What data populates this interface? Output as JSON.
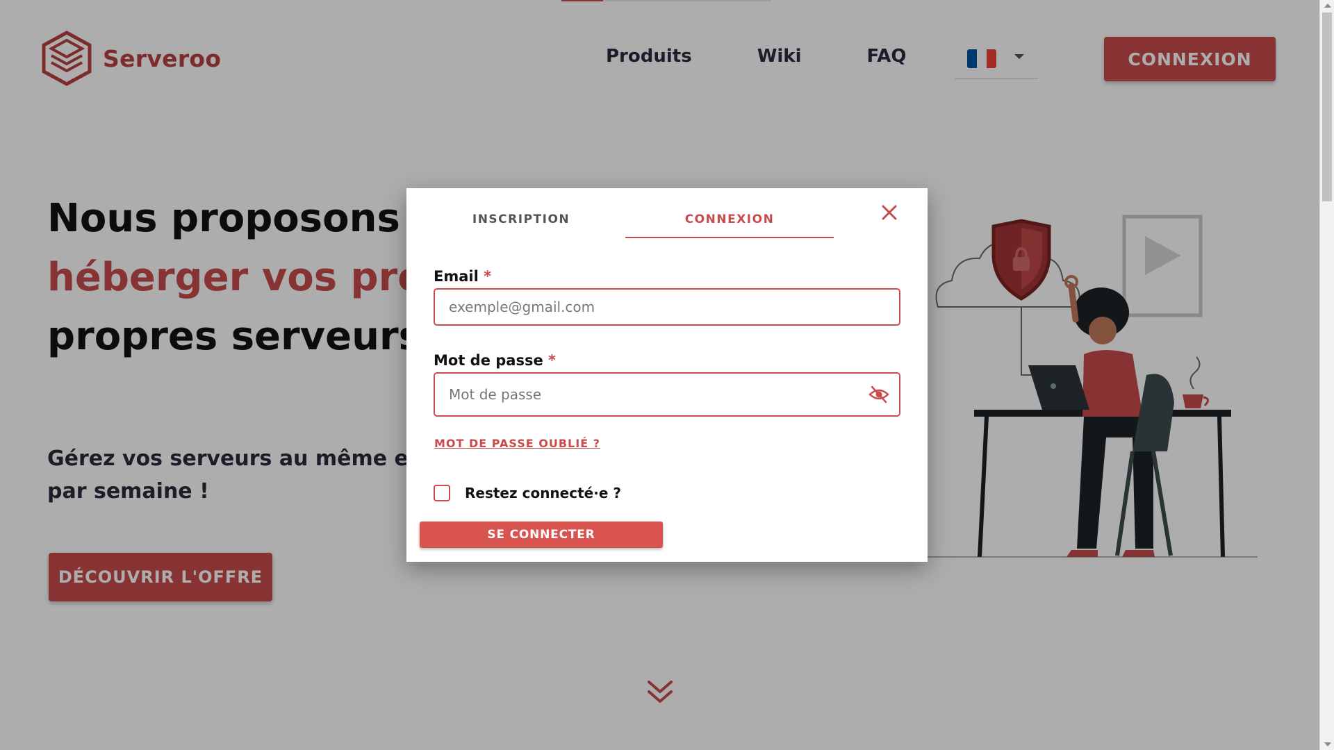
{
  "brand": {
    "name": "Serveroo",
    "color": "#c84c4c"
  },
  "nav": {
    "items": [
      "Produits",
      "Wiki",
      "FAQ"
    ]
  },
  "language": {
    "selected": "fr",
    "flag_colors": [
      "#0055a4",
      "#ffffff",
      "#ef4135"
    ]
  },
  "header": {
    "login_label": "CONNEXION"
  },
  "top_progress": {
    "fraction": 0.2
  },
  "hero": {
    "title_part1": "Nous proposons une solution pour ",
    "title_accent": "héberger vos projets",
    "title_part2": " digitaux sur nos propres serveurs",
    "subtitle": "Gérez vos serveurs au même endroit, à partir de 2€ par semaine !",
    "cta_label": "DÉCOUVRIR L'OFFRE"
  },
  "modal": {
    "tabs": [
      {
        "label": "INSCRIPTION",
        "active": false
      },
      {
        "label": "CONNEXION",
        "active": true
      }
    ],
    "email": {
      "label": "Email",
      "required_mark": "*",
      "placeholder": "exemple@gmail.com",
      "value": ""
    },
    "password": {
      "label": "Mot de passe",
      "required_mark": "*",
      "placeholder": "Mot de passe",
      "value": ""
    },
    "forgot_label": "MOT DE PASSE OUBLIÉ ?",
    "remember_label": "Restez connecté·e ?",
    "remember_checked": false,
    "submit_label": "SE CONNECTER",
    "icons": {
      "close": "close-icon",
      "visibility": "eye-off-icon"
    }
  }
}
